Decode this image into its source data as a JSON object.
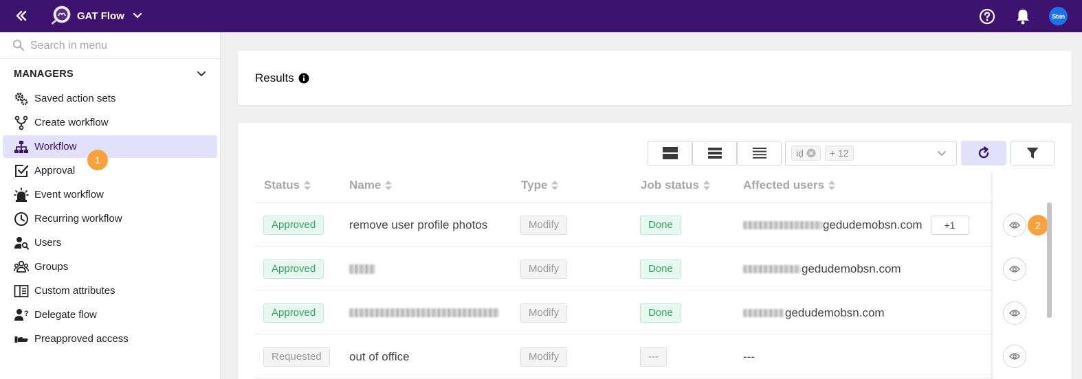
{
  "app": {
    "title": "GAT Flow",
    "avatar_label": "Stan"
  },
  "colors": {
    "topbar": "#3e1370",
    "active_item_bg": "#e1e1fb",
    "approved": "#2ea464",
    "badge": "#f7a23a",
    "avatar": "#1a73e8"
  },
  "sidebar": {
    "search_placeholder": "Search in menu",
    "section_title": "MANAGERS",
    "items": [
      {
        "label": "Saved action sets",
        "icon": "gears-icon"
      },
      {
        "label": "Create workflow",
        "icon": "branch-icon"
      },
      {
        "label": "Workflow",
        "icon": "hierarchy-icon",
        "active": true
      },
      {
        "label": "Approval",
        "icon": "checkbox-icon"
      },
      {
        "label": "Event workflow",
        "icon": "siren-icon"
      },
      {
        "label": "Recurring workflow",
        "icon": "clock-icon"
      },
      {
        "label": "Users",
        "icon": "user-search-icon"
      },
      {
        "label": "Groups",
        "icon": "group-icon"
      },
      {
        "label": "Custom attributes",
        "icon": "panel-icon"
      },
      {
        "label": "Delegate flow",
        "icon": "user-question-icon"
      },
      {
        "label": "Preapproved access",
        "icon": "hand-icon"
      }
    ]
  },
  "annotations": {
    "badge1": "1",
    "badge2": "2"
  },
  "results": {
    "title": "Results"
  },
  "toolbar": {
    "column_tag": "id",
    "more_tag": "+ 12"
  },
  "table": {
    "headers": [
      "Status",
      "Name",
      "Type",
      "Job status",
      "Affected users"
    ],
    "rows": [
      {
        "status": "Approved",
        "name": "remove user profile photos",
        "type": "Modify",
        "job_status": "Done",
        "users": "gedudemobsn.com",
        "extra": "+1"
      },
      {
        "status": "Approved",
        "name": "",
        "type": "Modify",
        "job_status": "Done",
        "users": "gedudemobsn.com",
        "extra": ""
      },
      {
        "status": "Approved",
        "name": "",
        "type": "Modify",
        "job_status": "Done",
        "users": "gedudemobsn.com",
        "extra": ""
      },
      {
        "status": "Requested",
        "name": "out of office",
        "type": "Modify",
        "job_status": "---",
        "users": "---",
        "extra": ""
      }
    ]
  }
}
